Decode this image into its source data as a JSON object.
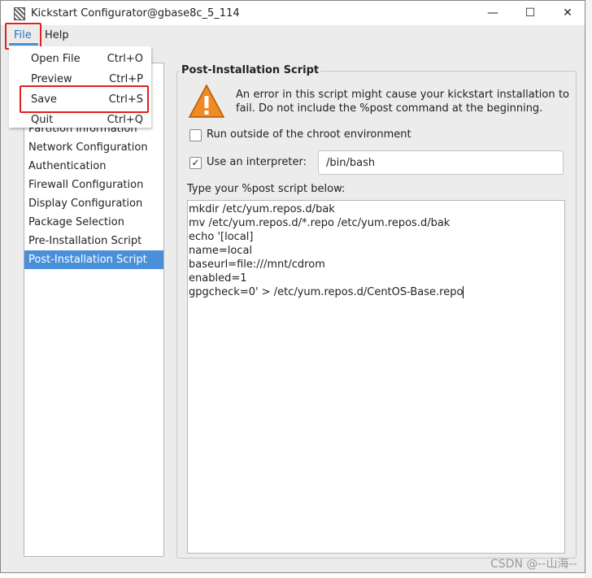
{
  "window": {
    "title": "Kickstart Configurator@gbase8c_5_114",
    "minimize": "—",
    "maximize": "☐",
    "close": "✕"
  },
  "menubar": {
    "file": "File",
    "help": "Help"
  },
  "file_menu": [
    {
      "label": "Open File",
      "shortcut": "Ctrl+O"
    },
    {
      "label": "Preview",
      "shortcut": "Ctrl+P"
    },
    {
      "label": "Save",
      "shortcut": "Ctrl+S"
    },
    {
      "label": "Quit",
      "shortcut": "Ctrl+Q"
    }
  ],
  "sidebar": {
    "items": [
      {
        "label": "Partition Information"
      },
      {
        "label": "Network Configuration"
      },
      {
        "label": "Authentication"
      },
      {
        "label": "Firewall Configuration"
      },
      {
        "label": "Display Configuration"
      },
      {
        "label": "Package Selection"
      },
      {
        "label": "Pre-Installation Script"
      },
      {
        "label": "Post-Installation Script",
        "selected": true
      }
    ]
  },
  "panel": {
    "title": "Post-Installation Script",
    "warning": "An error in this script might cause your kickstart installation to fail. Do not include the %post command at the beginning.",
    "chroot_label": "Run outside of the chroot environment",
    "chroot_checked": false,
    "interpreter_label": "Use an interpreter:",
    "interpreter_checked": true,
    "interpreter_value": "/bin/bash",
    "script_label": "Type your %post script below:",
    "script": "mkdir /etc/yum.repos.d/bak\nmv /etc/yum.repos.d/*.repo /etc/yum.repos.d/bak\necho '[local]\nname=local\nbaseurl=file:///mnt/cdrom\nenabled=1\ngpgcheck=0' > /etc/yum.repos.d/CentOS-Base.repo"
  },
  "watermark": "CSDN @--山海--",
  "colors": {
    "accent": "#4a90d9",
    "highlight": "#e02020"
  }
}
